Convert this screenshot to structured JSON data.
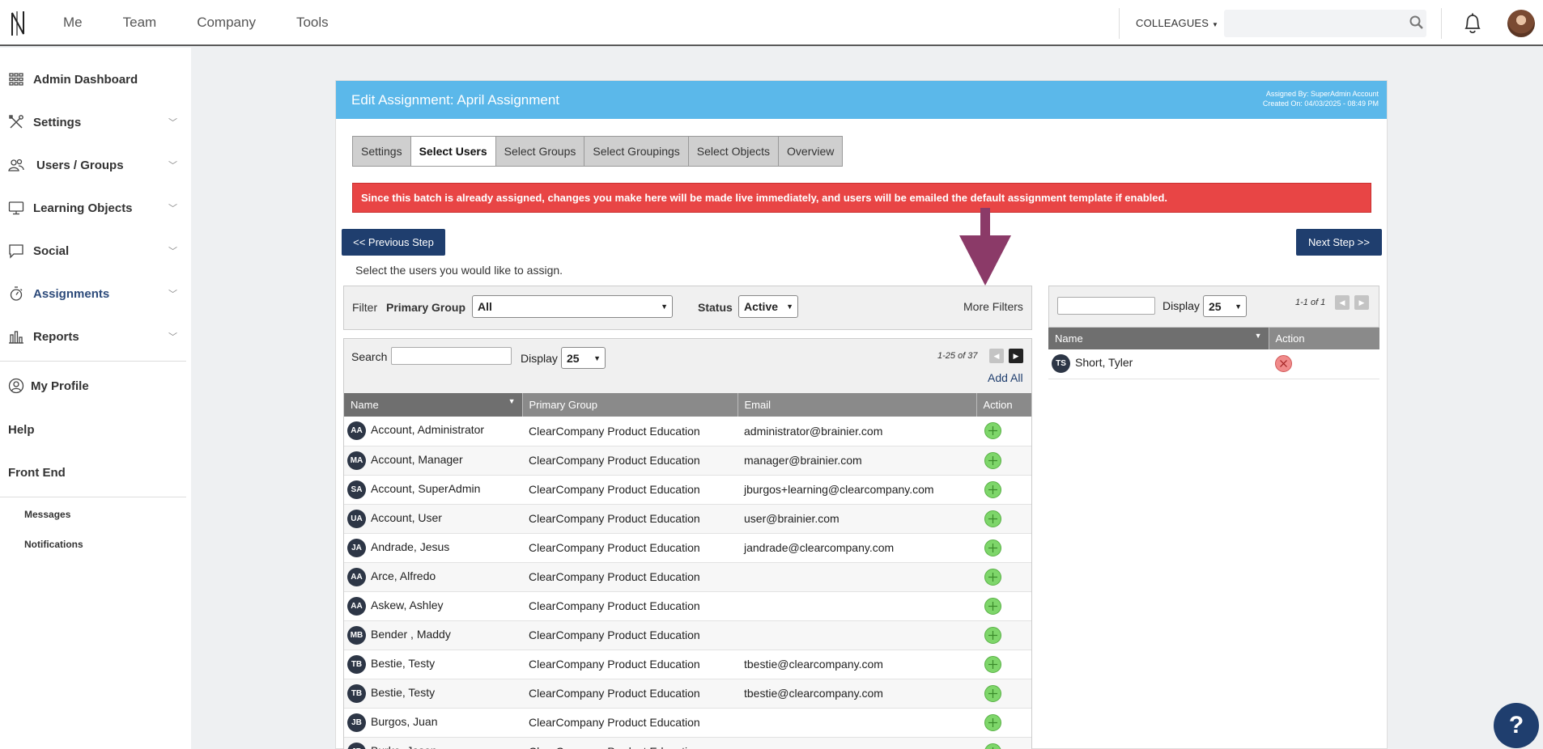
{
  "topbar": {
    "nav": [
      "Me",
      "Team",
      "Company",
      "Tools"
    ],
    "colleagues_label": "COLLEAGUES",
    "search_placeholder": ""
  },
  "sidebar": {
    "items": [
      {
        "label": "Admin Dashboard",
        "icon": "grid-icon",
        "chevron": false
      },
      {
        "label": "Settings",
        "icon": "tools-icon",
        "chevron": true
      },
      {
        "label": "Users / Groups",
        "icon": "users-icon",
        "chevron": true
      },
      {
        "label": "Learning Objects",
        "icon": "monitor-icon",
        "chevron": true
      },
      {
        "label": "Social",
        "icon": "chat-icon",
        "chevron": true
      },
      {
        "label": "Assignments",
        "icon": "stopwatch-icon",
        "chevron": true,
        "active": true
      },
      {
        "label": "Reports",
        "icon": "bar-chart-icon",
        "chevron": true
      }
    ],
    "my_profile": "My Profile",
    "help": "Help",
    "front_end": "Front End",
    "messages": "Messages",
    "notifications": "Notifications"
  },
  "panel": {
    "title": "Edit Assignment: April Assignment",
    "assigned_by": "Assigned By: SuperAdmin Account",
    "created_on": "Created On: 04/03/2025 - 08:49 PM",
    "tabs": [
      "Settings",
      "Select Users",
      "Select Groups",
      "Select Groupings",
      "Select Objects",
      "Overview"
    ],
    "active_tab": 1,
    "alert": "Since this batch is already assigned, changes you make here will be made live immediately, and users will be emailed the default assignment template if enabled.",
    "prev_button": "<< Previous Step",
    "next_button": "Next Step >>",
    "instructions": "Select the users you would like to assign."
  },
  "filter": {
    "filter_label": "Filter",
    "primary_group_label": "Primary Group",
    "primary_group_value": "All",
    "status_label": "Status",
    "status_value": "Active",
    "more_filters": "More Filters"
  },
  "users_table": {
    "search_label": "Search",
    "display_label": "Display",
    "display_value": "25",
    "pager": "1-25 of 37",
    "add_all": "Add All",
    "columns": [
      "Name",
      "Primary Group",
      "Email",
      "Action"
    ],
    "rows": [
      {
        "initials": "AA",
        "name": "Account, Administrator",
        "group": "ClearCompany Product Education",
        "email": "administrator@brainier.com"
      },
      {
        "initials": "MA",
        "name": "Account, Manager",
        "group": "ClearCompany Product Education",
        "email": "manager@brainier.com"
      },
      {
        "initials": "SA",
        "name": "Account, SuperAdmin",
        "group": "ClearCompany Product Education",
        "email": "jburgos+learning@clearcompany.com"
      },
      {
        "initials": "UA",
        "name": "Account, User",
        "group": "ClearCompany Product Education",
        "email": "user@brainier.com"
      },
      {
        "initials": "JA",
        "name": "Andrade, Jesus",
        "group": "ClearCompany Product Education",
        "email": "jandrade@clearcompany.com"
      },
      {
        "initials": "AA",
        "name": "Arce, Alfredo",
        "group": "ClearCompany Product Education",
        "email": ""
      },
      {
        "initials": "AA",
        "name": "Askew, Ashley",
        "group": "ClearCompany Product Education",
        "email": ""
      },
      {
        "initials": "MB",
        "name": "Bender , Maddy",
        "group": "ClearCompany Product Education",
        "email": ""
      },
      {
        "initials": "TB",
        "name": "Bestie, Testy",
        "group": "ClearCompany Product Education",
        "email": "tbestie@clearcompany.com"
      },
      {
        "initials": "TB",
        "name": "Bestie, Testy",
        "group": "ClearCompany Product Education",
        "email": "tbestie@clearcompany.com"
      },
      {
        "initials": "JB",
        "name": "Burgos, Juan",
        "group": "ClearCompany Product Education",
        "email": ""
      },
      {
        "initials": "JB",
        "name": "Burke, Jason",
        "group": "ClearCompany Product Education",
        "email": ""
      }
    ]
  },
  "selected_table": {
    "display_label": "Display",
    "display_value": "25",
    "pager": "1-1 of 1",
    "columns": [
      "Name",
      "Action"
    ],
    "rows": [
      {
        "initials": "TS",
        "name": "Short, Tyler"
      }
    ]
  },
  "help_button": "?",
  "colors": {
    "header_blue": "#5bb8ea",
    "dark_blue": "#1f3e6e",
    "alert_red": "#e84545",
    "arrow_purple": "#8b3a68"
  }
}
